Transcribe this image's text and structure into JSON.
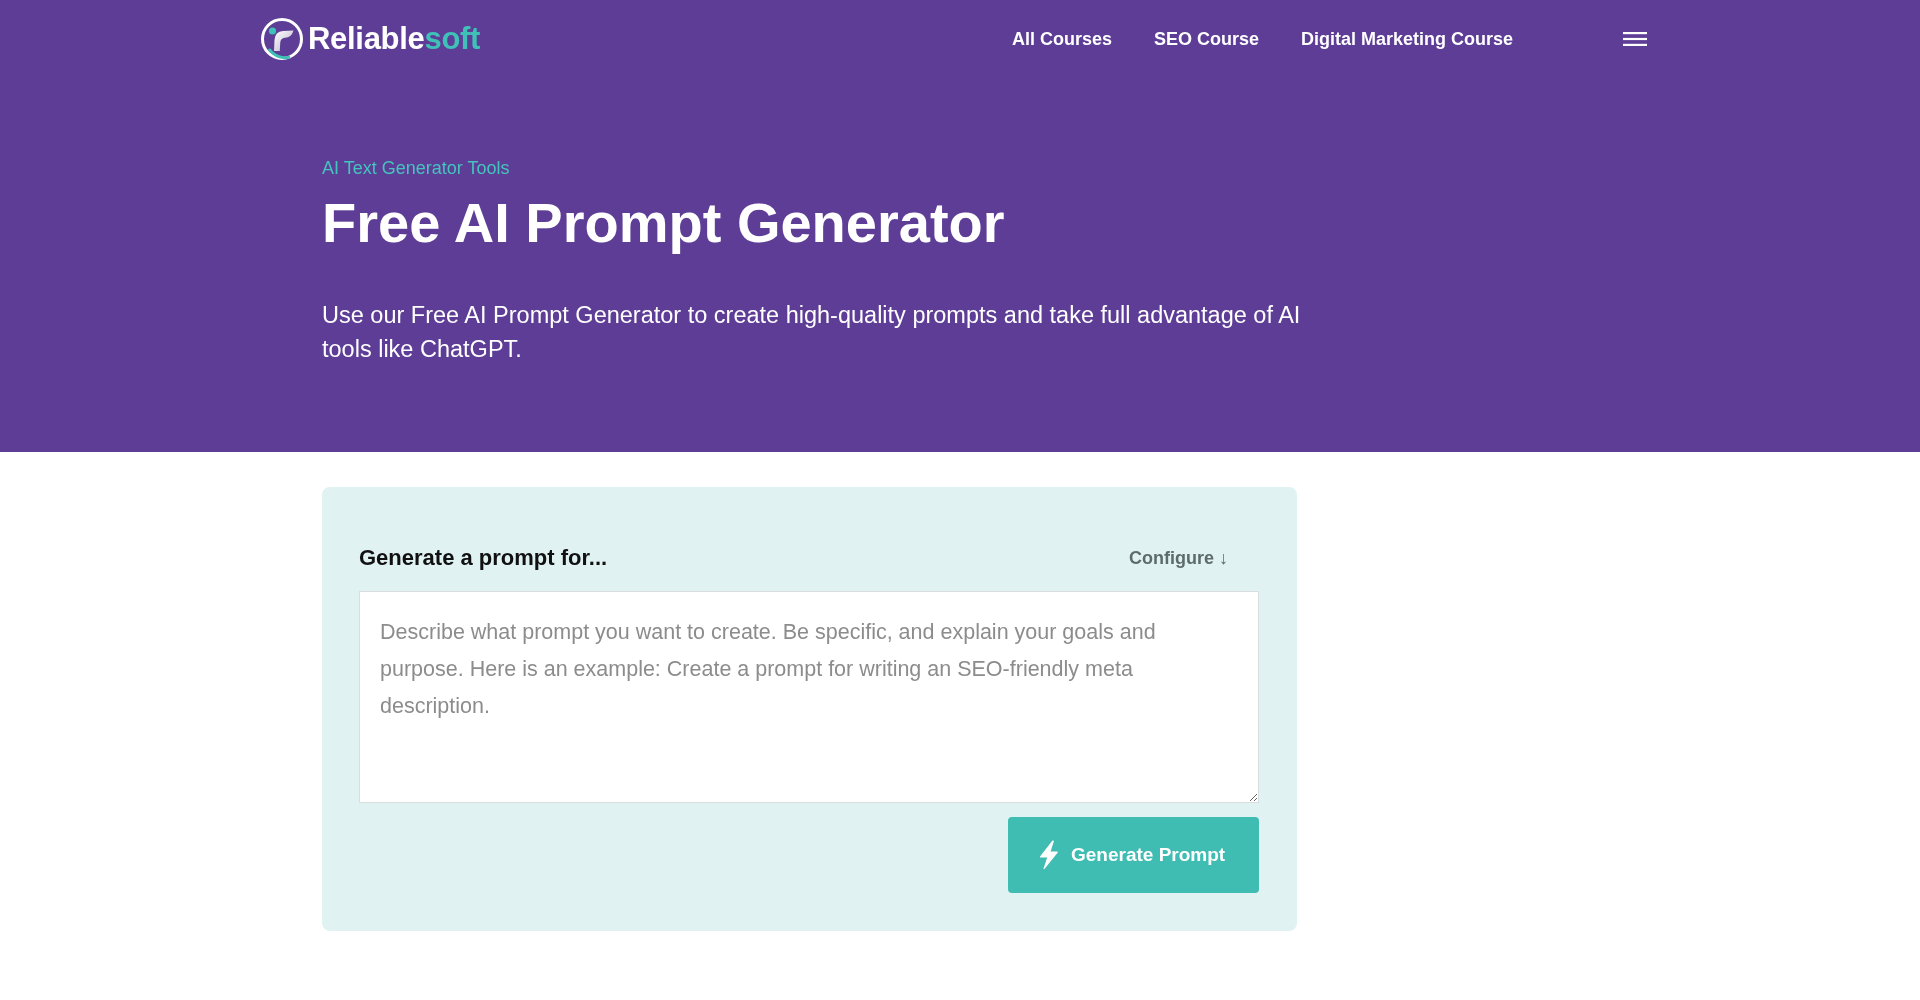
{
  "header": {
    "logo": {
      "primary": "Reliable",
      "accent": "soft"
    },
    "nav": [
      {
        "label": "All Courses"
      },
      {
        "label": "SEO Course"
      },
      {
        "label": "Digital Marketing Course"
      }
    ]
  },
  "hero": {
    "eyebrow": "AI Text Generator Tools",
    "title": "Free AI Prompt Generator",
    "description": "Use our Free AI Prompt Generator to create high-quality prompts and take full advantage of AI tools like ChatGPT."
  },
  "tool": {
    "heading": "Generate a prompt for...",
    "configure": {
      "label": "Configure ↓"
    },
    "prompt_field": {
      "placeholder": "Describe what prompt you want to create. Be specific, and explain your goals and purpose. Here is an example: Create a prompt for writing an SEO-friendly meta description."
    },
    "submit": {
      "label": "Generate Prompt"
    }
  }
}
